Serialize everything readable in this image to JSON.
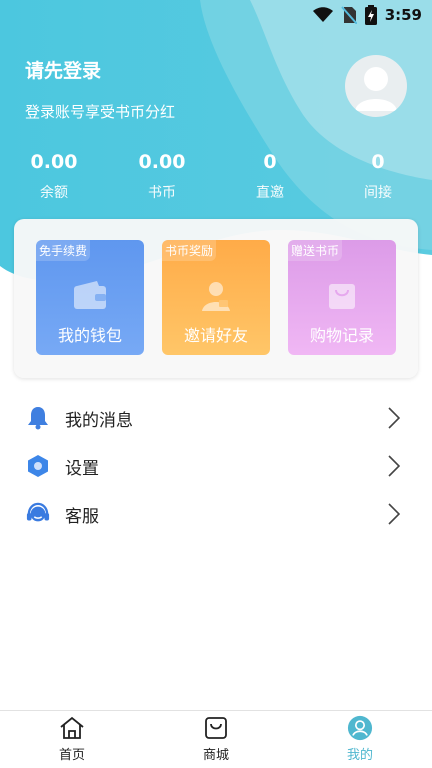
{
  "status_bar": {
    "time": "3:59"
  },
  "profile": {
    "title": "请先登录",
    "subtitle": "登录账号享受书币分红"
  },
  "stats": [
    {
      "value": "0.00",
      "label": "余额"
    },
    {
      "value": "0.00",
      "label": "书币"
    },
    {
      "value": "0",
      "label": "直邀"
    },
    {
      "value": "0",
      "label": "间接"
    }
  ],
  "tiles": [
    {
      "badge": "免手续费",
      "label": "我的钱包"
    },
    {
      "badge": "书币奖励",
      "label": "邀请好友"
    },
    {
      "badge": "赠送书币",
      "label": "购物记录"
    }
  ],
  "menu": [
    {
      "label": "我的消息",
      "icon": "bell-icon"
    },
    {
      "label": "设置",
      "icon": "hexagon-settings-icon"
    },
    {
      "label": "客服",
      "icon": "headset-icon"
    }
  ],
  "bottom_nav": [
    {
      "label": "首页",
      "icon": "home-icon",
      "active": false
    },
    {
      "label": "商城",
      "icon": "shop-bag-icon",
      "active": false
    },
    {
      "label": "我的",
      "icon": "user-icon",
      "active": true
    }
  ],
  "colors": {
    "header_cyan": "#4ec6dd",
    "active_tab": "#4fb7cf",
    "bell": "#3f7fe0",
    "settings": "#3d86e8",
    "headset": "#3a7be0"
  }
}
